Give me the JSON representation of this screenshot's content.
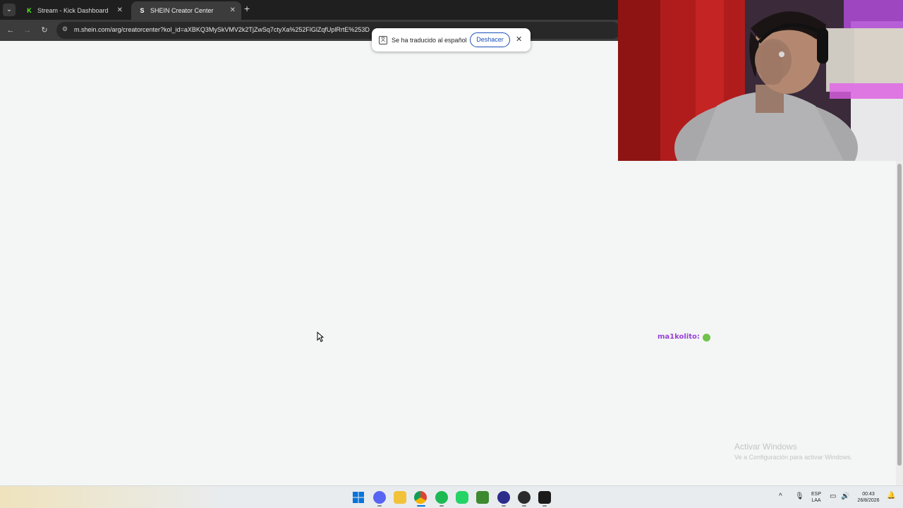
{
  "browser": {
    "tabs": [
      {
        "label": "Stream - Kick Dashboard",
        "favicon": "kick-icon",
        "active": false
      },
      {
        "label": "SHEIN Creator Center",
        "favicon": "shein-icon",
        "active": true
      }
    ],
    "url": "m.shein.com/arg/creatorcenter?kol_id=aXBKQ3MySkVMV2k2TjZwSq7ctyXa%252FlGlZqfUplRrtE%253D"
  },
  "translate_bubble": {
    "message": "Se ha traducido al español",
    "undo_label": "Deshacer"
  },
  "chat": {
    "username": "ma1kolito:"
  },
  "windows_watermark": {
    "title": "Activar Windows",
    "subtitle": "Ve a Configuración para activar Windows."
  },
  "taskbar": {
    "language": "ESP",
    "layout": "LAA",
    "time": "00:43",
    "date": "26/8/2026"
  }
}
